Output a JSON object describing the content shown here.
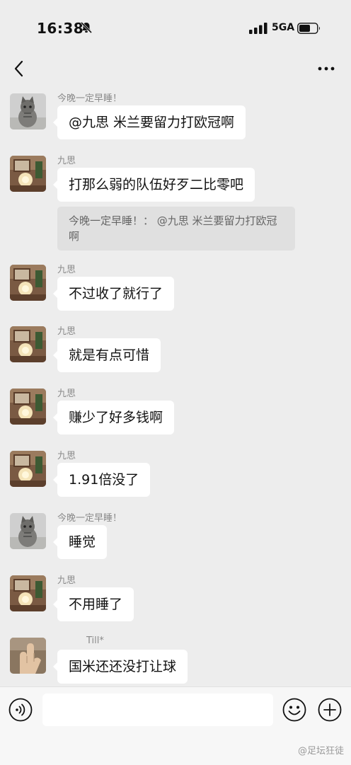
{
  "status_bar": {
    "time": "16:38",
    "network": "5GA",
    "icons": [
      "bell-muted-icon",
      "cellular-signal-icon",
      "battery-icon"
    ]
  },
  "nav": {
    "back_icon": "chevron-left-icon",
    "title": "",
    "more_icon": "more-dots-icon"
  },
  "messages": [
    {
      "sender": "今晚一定早睡！",
      "text": "@九思 米兰要留力打欧冠啊",
      "avatar": "cat"
    },
    {
      "sender": "九思",
      "text": "打那么弱的队伍好歹二比零吧",
      "avatar": "room",
      "quote": "今晚一定早睡！： @九思 米兰要留力打欧冠啊"
    },
    {
      "sender": "九思",
      "text": "不过收了就行了",
      "avatar": "room"
    },
    {
      "sender": "九思",
      "text": "就是有点可惜",
      "avatar": "room"
    },
    {
      "sender": "九思",
      "text": "赚少了好多钱啊",
      "avatar": "room"
    },
    {
      "sender": "九思",
      "text": "1.91倍没了",
      "avatar": "room"
    },
    {
      "sender": "今晚一定早睡！",
      "text": "睡觉",
      "avatar": "cat"
    },
    {
      "sender": "九思",
      "text": "不用睡了",
      "avatar": "room"
    },
    {
      "sender": "Till*",
      "text": "国米还还没打让球",
      "avatar": "hand"
    }
  ],
  "input_bar": {
    "placeholder": "",
    "icons": [
      "voice-icon",
      "emoji-icon",
      "plus-icon"
    ]
  },
  "watermark": "@足坛狂徒"
}
